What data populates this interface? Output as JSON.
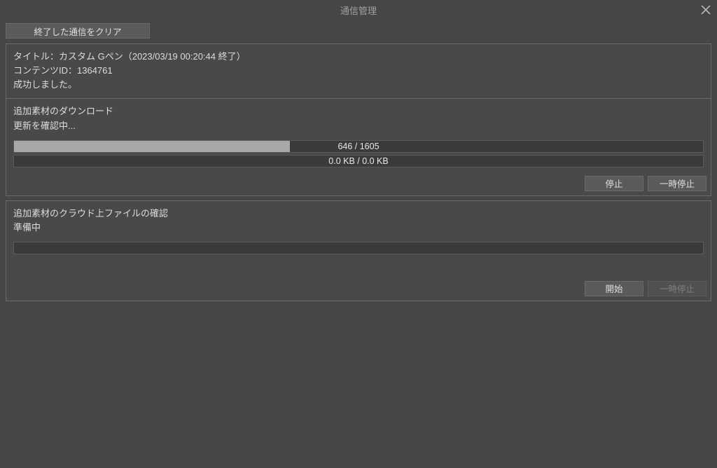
{
  "window": {
    "title": "通信管理"
  },
  "toolbar": {
    "clear_button": "終了した通信をクリア"
  },
  "task1": {
    "title_line": "タイトル：カスタム Gペン（2023/03/19  00:20:44 終了）",
    "content_id_line": "コンテンツID：1364761",
    "status": "成功しました。"
  },
  "task2": {
    "title": "追加素材のダウンロード",
    "status": "更新を確認中...",
    "progress_text": "646 / 1605",
    "progress_percent": 40,
    "speed_text": "0.0 KB / 0.0 KB",
    "stop_label": "停止",
    "pause_label": "一時停止"
  },
  "task3": {
    "title": "追加素材のクラウド上ファイルの確認",
    "status": "準備中",
    "start_label": "開始",
    "pause_label": "一時停止"
  }
}
